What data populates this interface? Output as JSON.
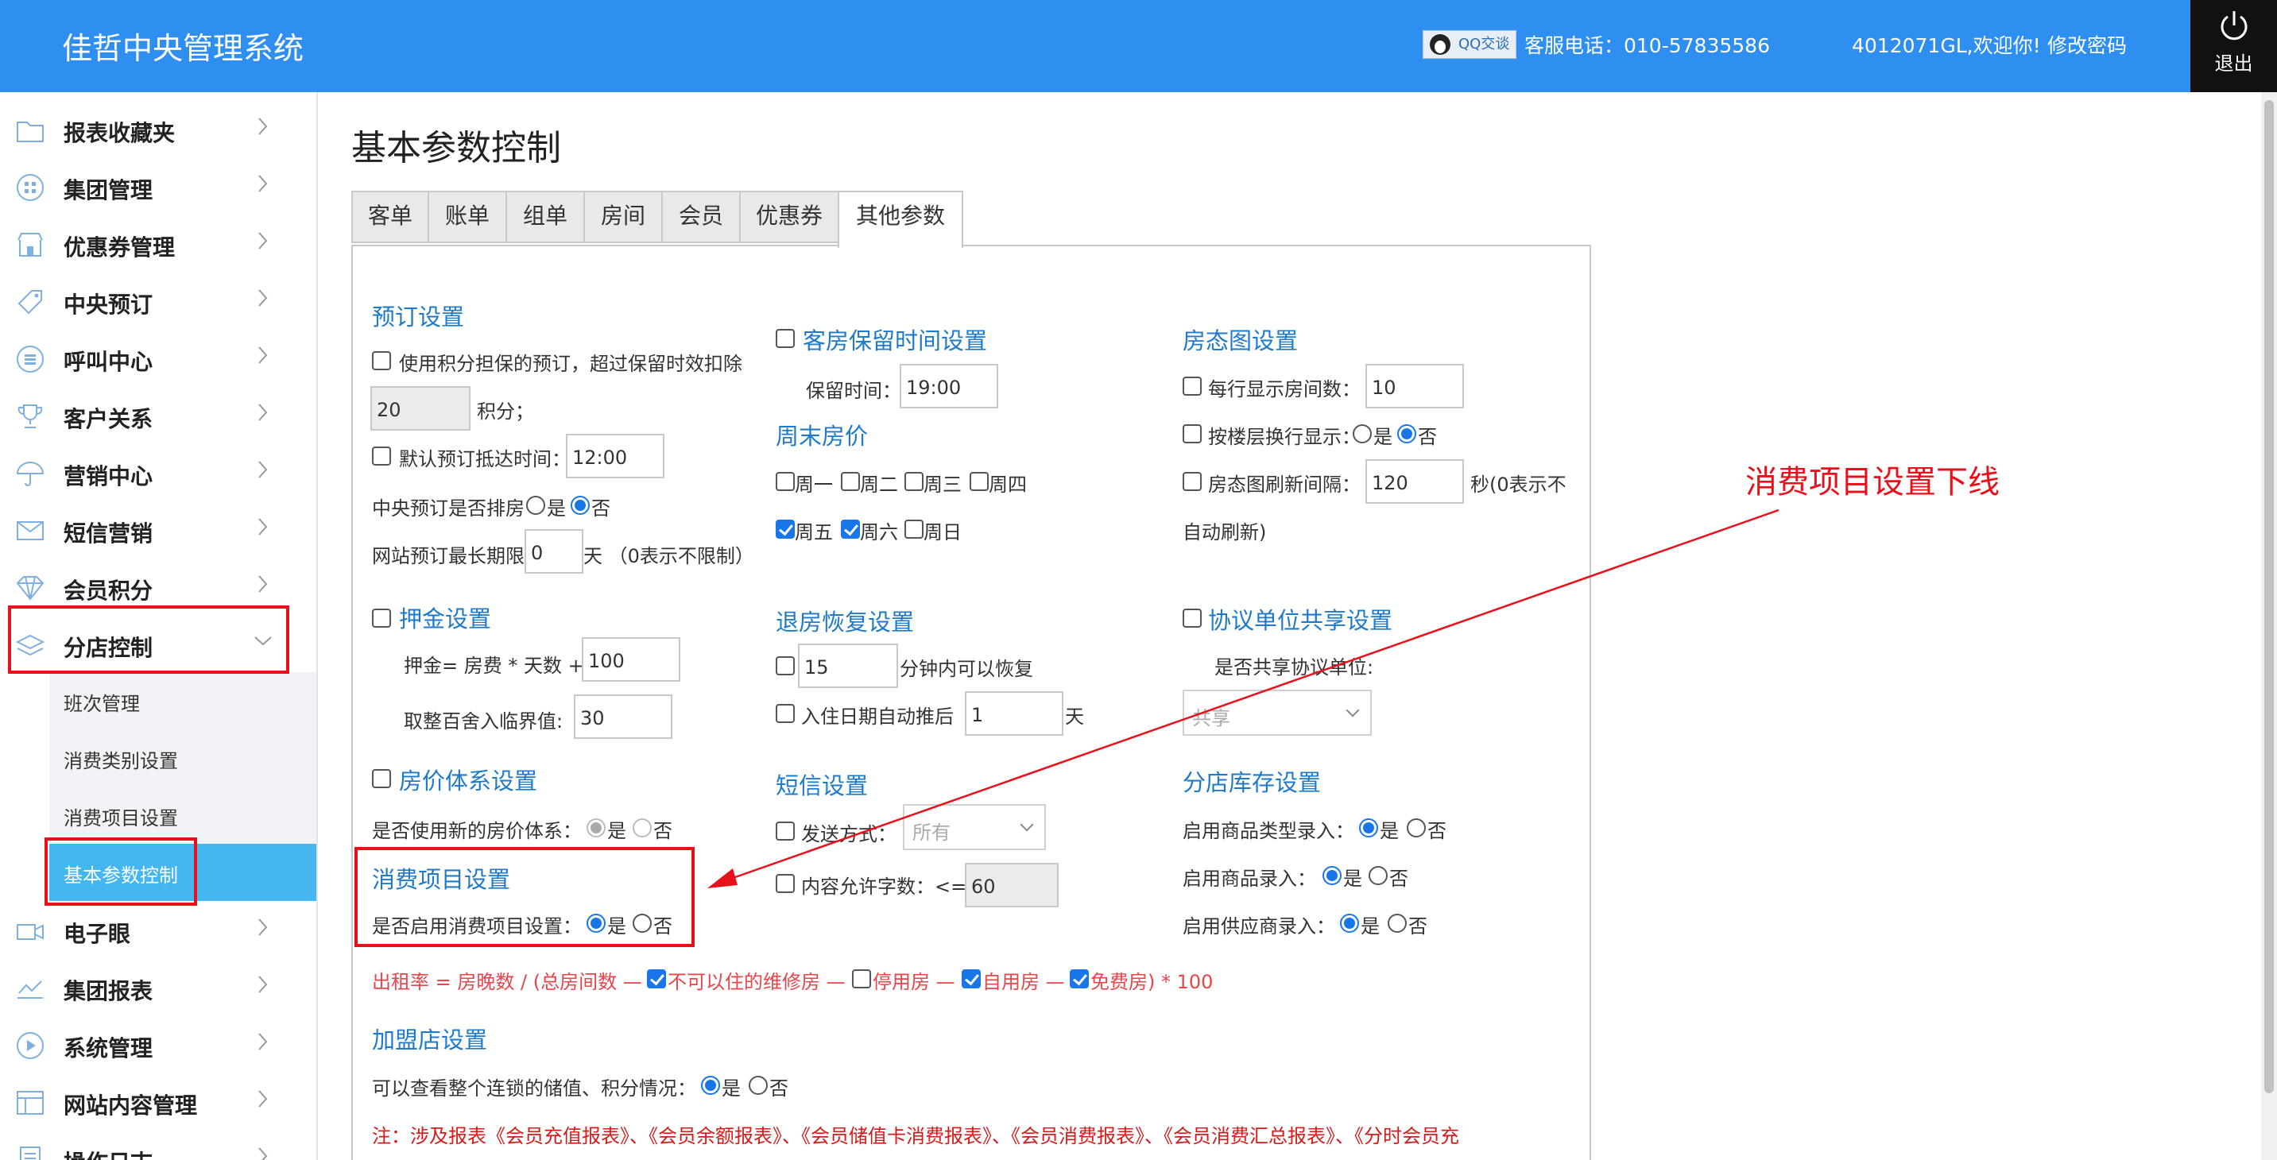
{
  "app": {
    "title": "佳哲中央管理系统"
  },
  "header": {
    "qq_label": "QQ交谈",
    "hotline": "客服电话：010-57835586",
    "welcome": "4012071GL,欢迎你!",
    "change_password": "修改密码",
    "logout": "退出"
  },
  "sidebar": {
    "items": [
      {
        "label": "报表收藏夹",
        "icon": "folder-icon"
      },
      {
        "label": "集团管理",
        "icon": "grid-icon"
      },
      {
        "label": "优惠券管理",
        "icon": "store-icon"
      },
      {
        "label": "中央预订",
        "icon": "tag-icon"
      },
      {
        "label": "呼叫中心",
        "icon": "phone-icon"
      },
      {
        "label": "客户关系",
        "icon": "trophy-icon"
      },
      {
        "label": "营销中心",
        "icon": "umbrella-icon"
      },
      {
        "label": "短信营销",
        "icon": "mail-icon"
      },
      {
        "label": "会员积分",
        "icon": "diamond-icon"
      },
      {
        "label": "分店控制",
        "icon": "layers-icon"
      },
      {
        "label": "电子眼",
        "icon": "camera-icon"
      },
      {
        "label": "集团报表",
        "icon": "chart-icon"
      },
      {
        "label": "系统管理",
        "icon": "play-icon"
      },
      {
        "label": "网站内容管理",
        "icon": "table-icon"
      },
      {
        "label": "操作日志",
        "icon": "log-icon"
      }
    ],
    "sub_items": [
      "班次管理",
      "消费类别设置",
      "消费项目设置",
      "基本参数控制"
    ]
  },
  "main": {
    "page_title": "基本参数控制",
    "tabs": [
      "客单",
      "账单",
      "组单",
      "房间",
      "会员",
      "优惠券",
      "其他参数"
    ],
    "active_tab": "其他参数"
  },
  "booking": {
    "title": "预订设置",
    "points_label": "使用积分担保的预订，超过保留时效扣除",
    "points_value": "20",
    "points_unit": "积分；",
    "arrival_label": "默认预订抵达时间：",
    "arrival_value": "12:00",
    "central_rank_label": "中央预订是否排房",
    "yes": "是",
    "no": "否",
    "web_limit_label": "网站预订最长期限",
    "web_limit_value": "0",
    "web_limit_unit": "天 （0表示不限制）"
  },
  "room_hold": {
    "title": "客房保留时间设置",
    "hold_label": "保留时间：",
    "hold_value": "19:00"
  },
  "weekend": {
    "title": "周末房价",
    "days": [
      "周一",
      "周二",
      "周三",
      "周四",
      "周五",
      "周六",
      "周日"
    ],
    "checked": [
      false,
      false,
      false,
      false,
      true,
      true,
      false
    ]
  },
  "roomstate": {
    "title": "房态图设置",
    "per_row_label": "每行显示房间数：",
    "per_row_value": "10",
    "floor_wrap_label": "按楼层换行显示：",
    "refresh_label": "房态图刷新间隔：",
    "refresh_value": "120",
    "refresh_unit": "秒(0表示不",
    "refresh_unit2": "自动刷新)"
  },
  "deposit": {
    "title": "押金设置",
    "formula_label": "押金= 房费 * 天数 +",
    "formula_value": "100",
    "round_label": "取整百舍入临界值:",
    "round_value": "30"
  },
  "checkout_restore": {
    "title": "退房恢复设置",
    "minutes_value": "15",
    "minutes_label": "分钟内可以恢复",
    "postpone_label": "入住日期自动推后",
    "postpone_value": "1",
    "postpone_unit": "天"
  },
  "agreement": {
    "title": "协议单位共享设置",
    "share_label": "是否共享协议单位:",
    "share_value": "共享"
  },
  "price_system": {
    "title": "房价体系设置",
    "new_label": "是否使用新的房价体系："
  },
  "sms": {
    "title": "短信设置",
    "method_label": "发送方式：",
    "method_value": "所有",
    "length_label": "内容允许字数：<=",
    "length_value": "60"
  },
  "stock": {
    "title": "分店库存设置",
    "type_label": "启用商品类型录入：",
    "goods_label": "启用商品录入：",
    "supplier_label": "启用供应商录入："
  },
  "consume": {
    "title": "消费项目设置",
    "enable_label": "是否启用消费项目设置："
  },
  "occupancy": {
    "prefix": "出租率 = 房晚数 / (总房间数 —",
    "items": [
      "不可以住的维修房 —",
      "停用房 —",
      "自用房 —",
      "免费房) * 100"
    ],
    "checked": [
      true,
      false,
      true,
      true
    ]
  },
  "franchise": {
    "title": "加盟店设置",
    "view_label": "可以查看整个连锁的储值、积分情况：",
    "note": "注：涉及报表《会员充值报表》、《会员余额报表》、《会员储值卡消费报表》、《会员消费报表》、《会员消费汇总报表》、《分时会员充"
  },
  "annotation": {
    "text": "消费项目设置下线",
    "color": "#e8101a"
  }
}
